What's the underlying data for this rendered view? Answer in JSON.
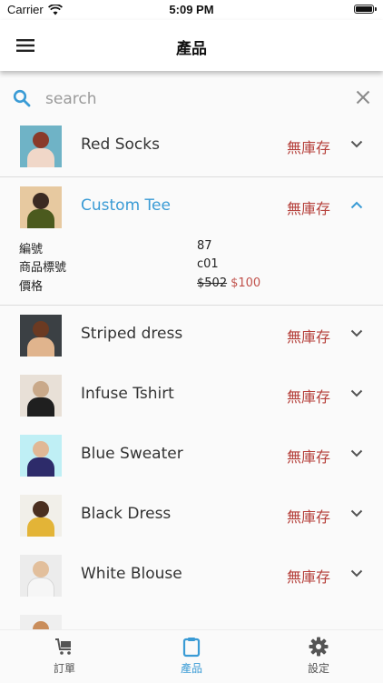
{
  "status_bar": {
    "carrier": "Carrier",
    "time": "5:09 PM"
  },
  "app_bar": {
    "title": "產品"
  },
  "search": {
    "placeholder": "search",
    "value": ""
  },
  "products": [
    {
      "name": "Red Socks",
      "stock": "無庫存",
      "expanded": false,
      "colors": [
        "#6fb3c6",
        "#8a3b2a",
        "#f0d7c8"
      ]
    },
    {
      "name": "Custom Tee",
      "stock": "無庫存",
      "expanded": true,
      "colors": [
        "#e7c9a0",
        "#3b2a22",
        "#4b5a1e"
      ]
    },
    {
      "name": "Striped dress",
      "stock": "無庫存",
      "expanded": false,
      "colors": [
        "#3b4044",
        "#6b3a22",
        "#e0b48d"
      ]
    },
    {
      "name": "Infuse Tshirt",
      "stock": "無庫存",
      "expanded": false,
      "colors": [
        "#2a2a2a",
        "#e8e0d7",
        "#1f1f1f"
      ]
    },
    {
      "name": "Blue Sweater",
      "stock": "無庫存",
      "expanded": false,
      "colors": [
        "#bfeff5",
        "#e0b896",
        "#2d2b6a"
      ]
    },
    {
      "name": "Black Dress",
      "stock": "無庫存",
      "expanded": false,
      "colors": [
        "#f1efe9",
        "#4a2f20",
        "#e3b437"
      ]
    },
    {
      "name": "White Blouse",
      "stock": "無庫存",
      "expanded": false,
      "colors": [
        "#ececec",
        "#e2bf9c",
        "#f6f6f6"
      ]
    }
  ],
  "detail": {
    "id_label": "編號",
    "id_value": "87",
    "sku_label": "商品標號",
    "sku_value": "c01",
    "price_label": "價格",
    "price_original": "$502",
    "price_sale": "$100"
  },
  "bottom_nav": {
    "items": [
      {
        "label": "訂單"
      },
      {
        "label": "產品"
      },
      {
        "label": "設定"
      }
    ]
  },
  "colors": {
    "accent": "#3a9bd5",
    "out_of_stock": "#b5403b"
  }
}
